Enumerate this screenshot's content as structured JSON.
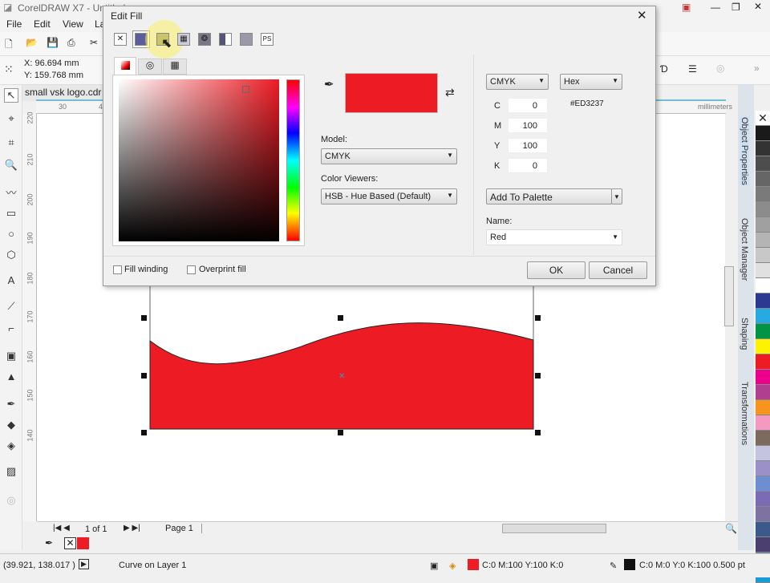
{
  "app": {
    "title": "CorelDRAW X7 - Untitled"
  },
  "menu": [
    "File",
    "Edit",
    "View",
    "La"
  ],
  "propbar": {
    "x": "X: 96.694 mm",
    "y": "Y: 159.768 mm"
  },
  "document": {
    "tab": "small vsk logo.cdr",
    "ruler_units": "millimeters",
    "hruler": [
      "30",
      "40"
    ],
    "vruler": [
      "220",
      "210",
      "200",
      "190",
      "180",
      "170",
      "160",
      "150",
      "140"
    ]
  },
  "dialog": {
    "title": "Edit Fill",
    "fill_types": [
      "no-fill",
      "uniform-fill",
      "fountain-fill",
      "vector-pattern",
      "bitmap-pattern",
      "two-color-pattern",
      "texture-fill",
      "postscript-fill"
    ],
    "model_label": "Model:",
    "model_value": "CMYK",
    "viewers_label": "Color Viewers:",
    "viewers_value": "HSB - Hue Based (Default)",
    "color_model": "CMYK",
    "hex_mode": "Hex",
    "hex_value": "#ED3237",
    "swatch_color": "#ed1c24",
    "channels": [
      {
        "label": "C",
        "value": "0"
      },
      {
        "label": "M",
        "value": "100"
      },
      {
        "label": "Y",
        "value": "100"
      },
      {
        "label": "K",
        "value": "0"
      }
    ],
    "add_to_palette": "Add To Palette",
    "name_label": "Name:",
    "name_value": "Red",
    "fill_winding": "Fill winding",
    "overprint_fill": "Overprint fill",
    "ok": "OK",
    "cancel": "Cancel"
  },
  "dockers": [
    "Object Properties",
    "Object Manager",
    "Shaping",
    "Transformations"
  ],
  "palette": [
    "#1a1a1a",
    "#333333",
    "#4d4d4d",
    "#666666",
    "#7a7a7a",
    "#8c8c8c",
    "#a0a0a0",
    "#b4b4b4",
    "#c8c8c8",
    "#e0e0e0",
    "#ffffff",
    "#2b3990",
    "#27aae1",
    "#009444",
    "#fff200",
    "#ed1c24",
    "#ec008c",
    "#b0408f",
    "#f7941d",
    "#f49ac1",
    "#7d6a5e",
    "#c4c3e0",
    "#9b90c8",
    "#6d8fd0",
    "#7b6bb5",
    "#7c73a1",
    "#3b5a8c",
    "#4a3f6e",
    "#5b7ba0",
    "#1a9ad6"
  ],
  "nav": {
    "page_count": "1 of 1",
    "page_tab": "Page 1"
  },
  "status": {
    "coords": "(39.921, 138.017 )",
    "object": "Curve on Layer 1",
    "fill": "C:0 M:100 Y:100 K:0",
    "outline": "C:0 M:0 Y:0 K:100  0.500 pt",
    "fill_color": "#ed1c24",
    "outline_color": "#111111"
  }
}
